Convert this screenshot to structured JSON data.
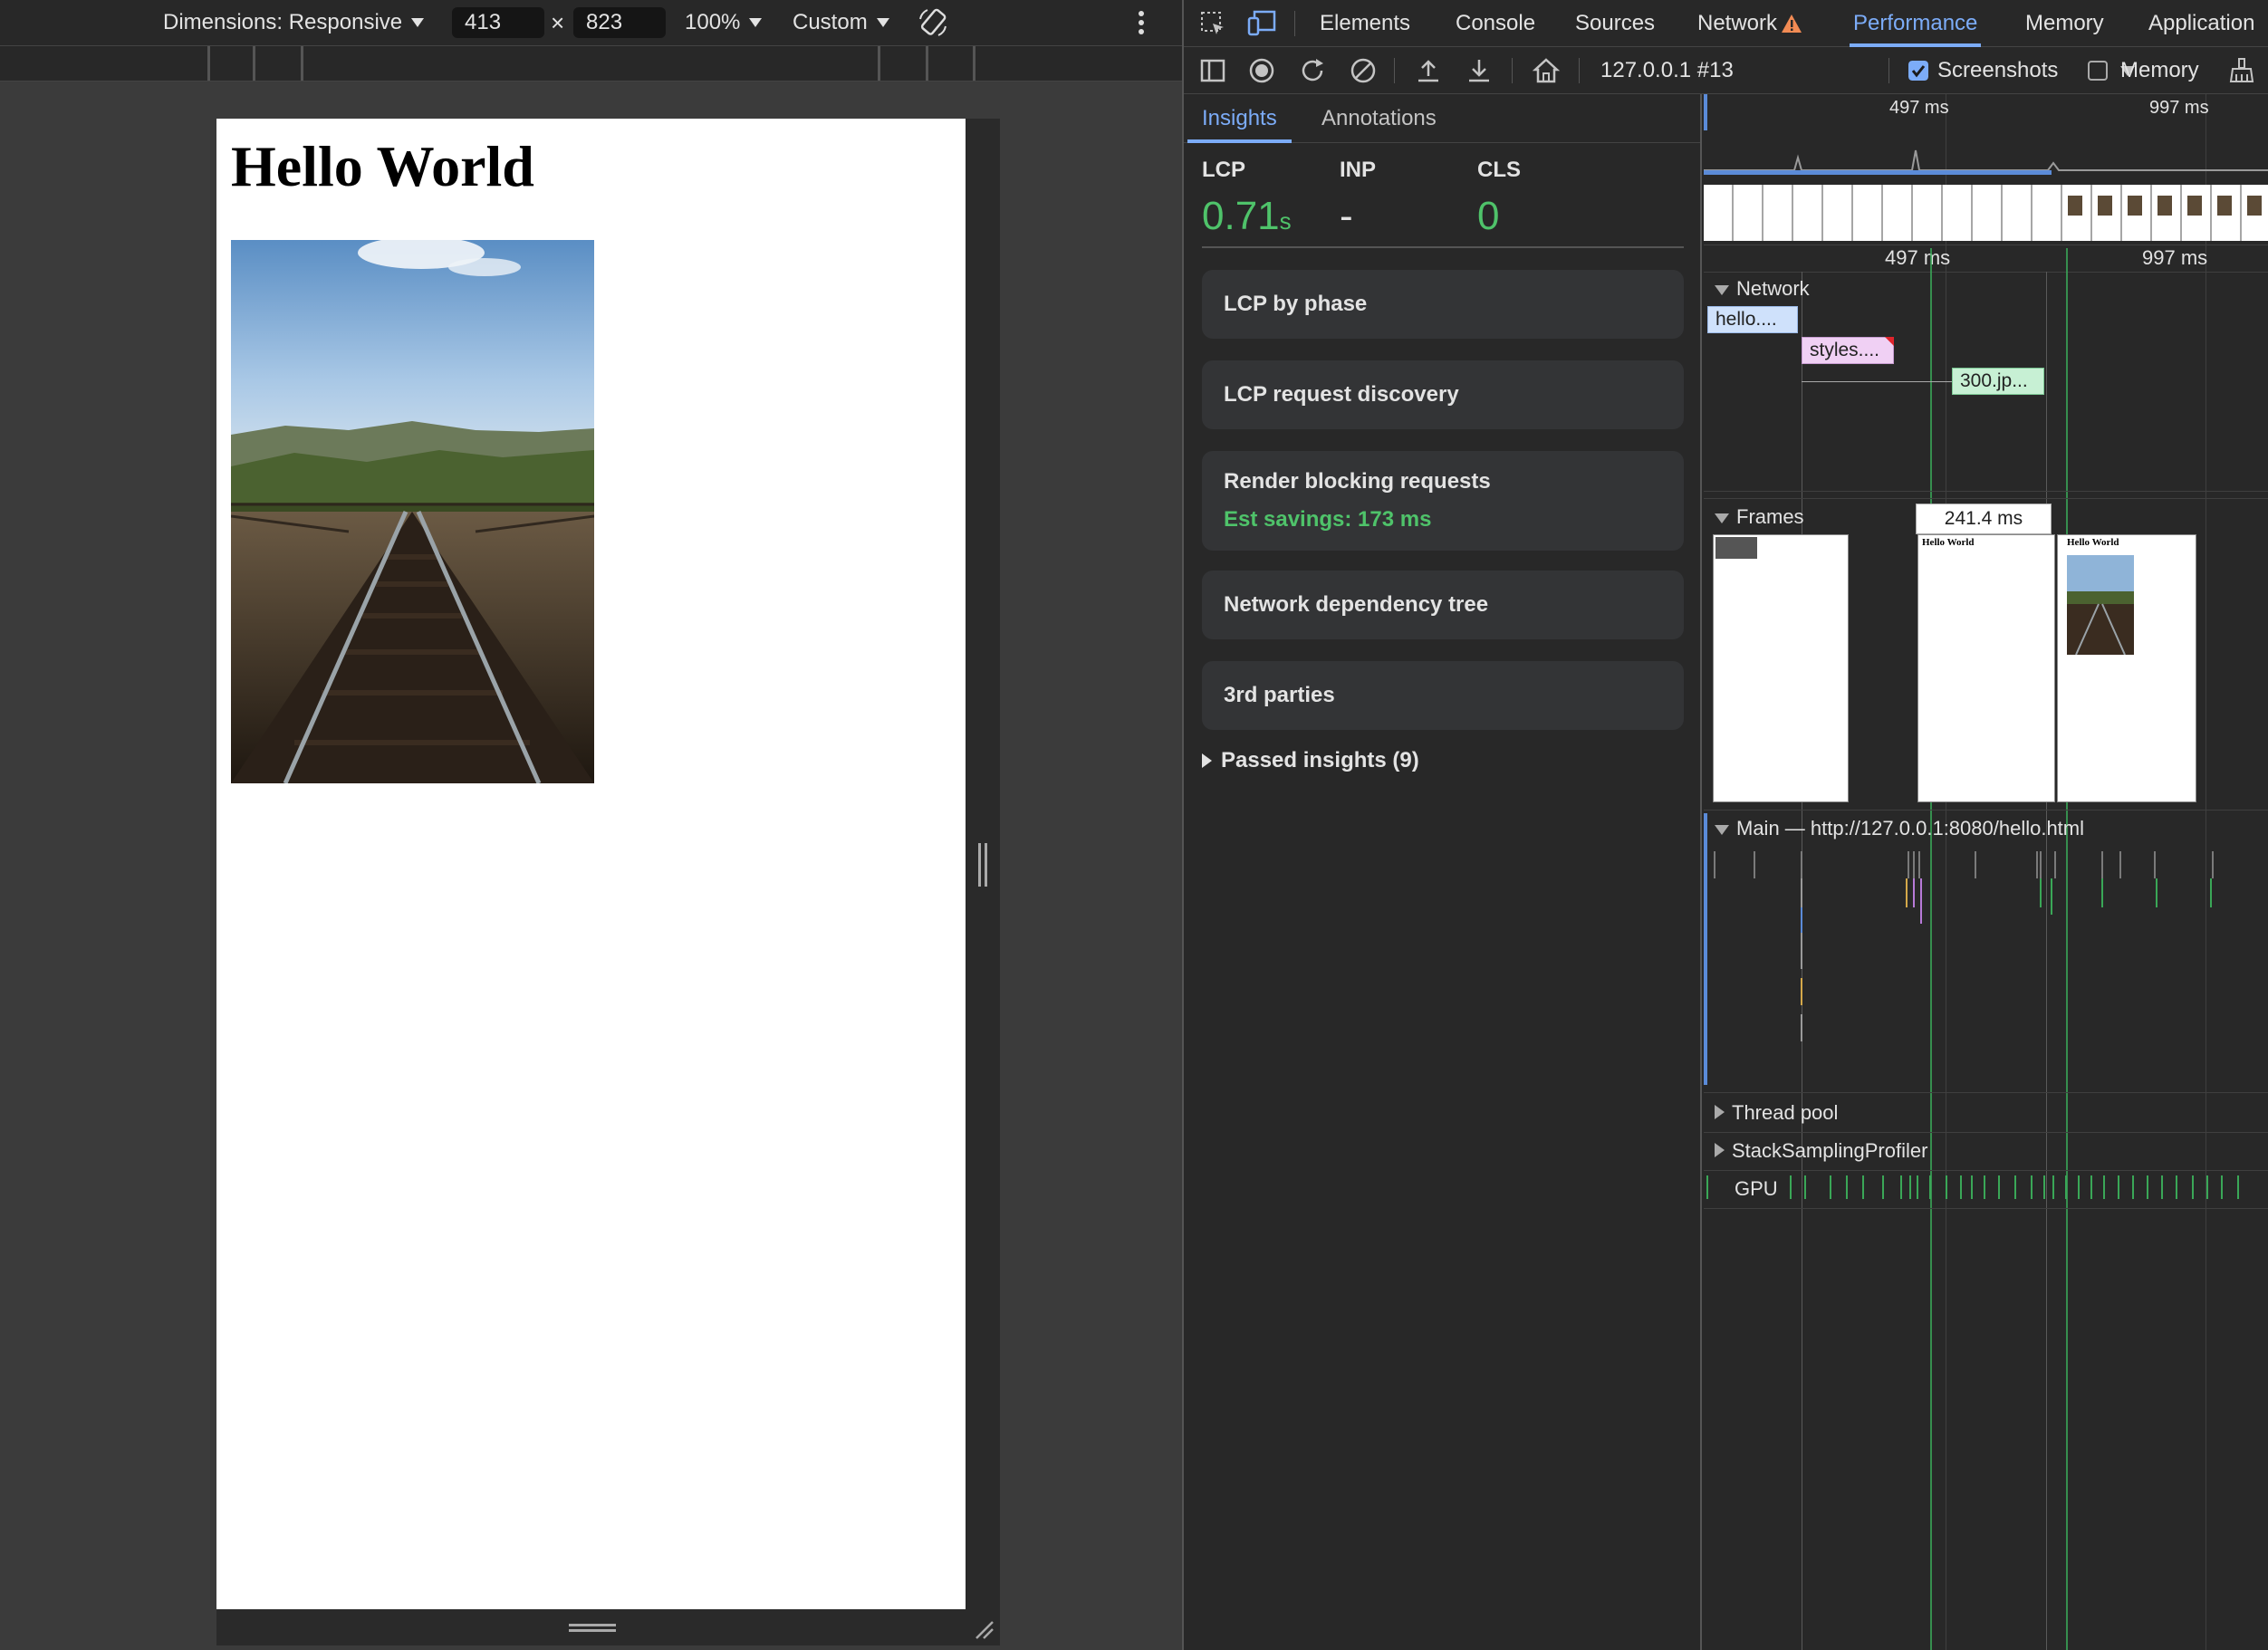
{
  "device_toolbar": {
    "dimensions_label": "Dimensions: Responsive",
    "width": "413",
    "times": "×",
    "height": "823",
    "zoom": "100%",
    "throttle": "Custom"
  },
  "page": {
    "heading": "Hello World"
  },
  "devtools": {
    "tabs": [
      "Elements",
      "Console",
      "Sources",
      "Network",
      "Performance",
      "Memory",
      "Application"
    ],
    "active_tab": "Performance",
    "recording": "127.0.0.1 #13",
    "screenshots_label": "Screenshots",
    "screenshots_checked": true,
    "memory_label": "Memory",
    "memory_checked": false
  },
  "insights": {
    "tabs": [
      "Insights",
      "Annotations"
    ],
    "metrics": [
      {
        "label": "LCP",
        "value": "0.71",
        "unit": "s"
      },
      {
        "label": "INP",
        "value": "-",
        "unit": ""
      },
      {
        "label": "CLS",
        "value": "0",
        "unit": ""
      }
    ],
    "cards": [
      {
        "title": "LCP by phase",
        "savings": ""
      },
      {
        "title": "LCP request discovery",
        "savings": ""
      },
      {
        "title": "Render blocking requests",
        "savings": "Est savings: 173 ms"
      },
      {
        "title": "Network dependency tree",
        "savings": ""
      },
      {
        "title": "3rd parties",
        "savings": ""
      }
    ],
    "passed": "Passed insights (9)"
  },
  "timeline": {
    "overview_ticks": [
      "497 ms",
      "997 ms"
    ],
    "ruler_ticks": [
      "497 ms",
      "997 ms"
    ],
    "network_label": "Network",
    "requests": [
      "hello....",
      "styles....",
      "300.jp..."
    ],
    "frames_label": "Frames",
    "frame_duration": "241.4 ms",
    "frame_thumb_text": "Hello World",
    "main_label": "Main — http://127.0.0.1:8080/hello.html",
    "tracks": [
      "Thread pool",
      "StackSamplingProfiler",
      "GPU"
    ]
  },
  "colors": {
    "accent": "#7cacf8",
    "good": "#4fc36a",
    "network_html": "#cfe1fb",
    "network_css": "#f0d0f4",
    "network_img": "#c7f0d4"
  }
}
